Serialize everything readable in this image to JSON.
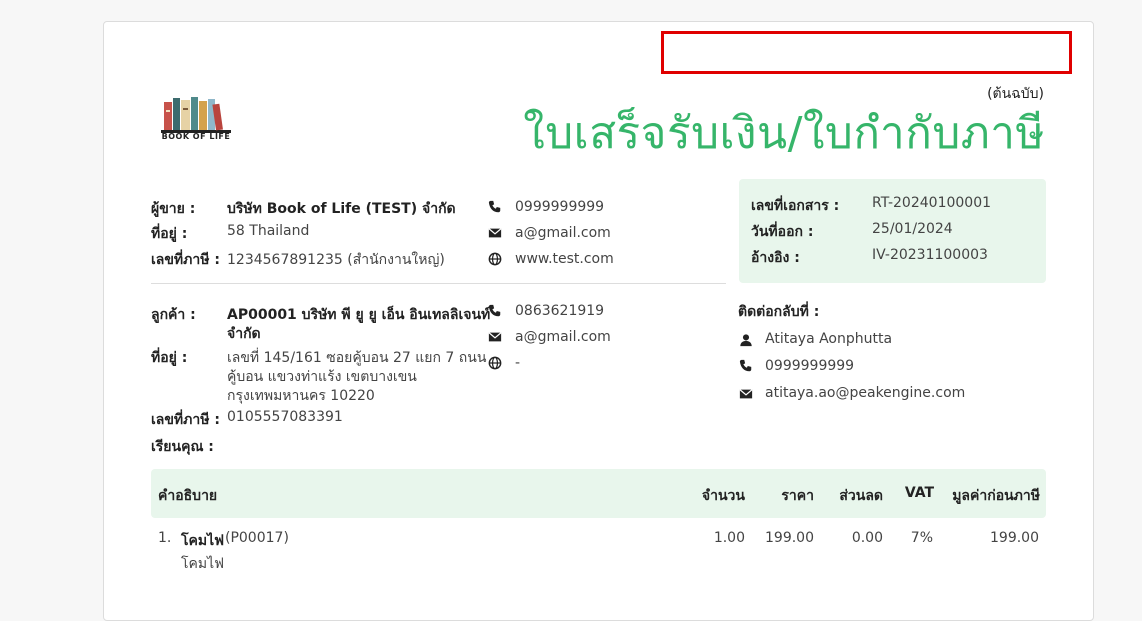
{
  "document": {
    "copy_label": "(ต้นฉบับ)",
    "title": "ใบเสร็จรับเงิน/ใบกำกับภาษี",
    "logo_text": "BOOK OF LIFE"
  },
  "seller": {
    "name_label": "ผู้ขาย :",
    "name": "บริษัท Book of Life (TEST) จำกัด",
    "address_label": "ที่อยู่ :",
    "address": "58 Thailand",
    "tax_label": "เลขที่ภาษี :",
    "tax_id": "1234567891235 (สำนักงานใหญ่)",
    "phone": "0999999999",
    "email": "a@gmail.com",
    "website": "www.test.com"
  },
  "customer": {
    "name_label": "ลูกค้า :",
    "name_line1": "AP00001 บริษัท พี ยู ยู เอ็น อินเทลลิเจนท์",
    "name_line2": "จำกัด",
    "address_label": "ที่อยู่ :",
    "address_line1": "เลขที่ 145/161 ซอยคู้บอน 27 แยก 7 ถนน",
    "address_line2": "คู้บอน  แขวงท่าแร้ง เขตบางเขน",
    "address_line3": "กรุงเทพมหานคร 10220",
    "tax_label": "เลขที่ภาษี :",
    "tax_id": "0105557083391",
    "attention_label": "เรียนคุณ :",
    "phone": "0863621919",
    "email": "a@gmail.com",
    "website": "-"
  },
  "doc_info": {
    "number_label": "เลขที่เอกสาร :",
    "number": "RT-20240100001",
    "date_label": "วันที่ออก :",
    "date": "25/01/2024",
    "ref_label": "อ้างอิง :",
    "ref": "IV-20231100003"
  },
  "contact": {
    "label": "ติดต่อกลับที่ :",
    "name": "Atitaya Aonphutta",
    "phone": "0999999999",
    "email": "atitaya.ao@peakengine.com"
  },
  "table": {
    "headers": {
      "description": "คำอธิบาย",
      "quantity": "จำนวน",
      "price": "ราคา",
      "discount": "ส่วนลด",
      "vat": "VAT",
      "amount": "มูลค่าก่อนภาษี"
    },
    "rows": [
      {
        "index": "1.",
        "name": "โคมไฟ",
        "code": "(P00017)",
        "detail": "โคมไฟ",
        "quantity": "1.00",
        "price": "199.00",
        "discount": "0.00",
        "vat": "7%",
        "amount": "199.00"
      }
    ]
  },
  "colors": {
    "title_green": "#36b56a",
    "panel_green": "#e8f6ec",
    "highlight_red": "#e00000"
  }
}
